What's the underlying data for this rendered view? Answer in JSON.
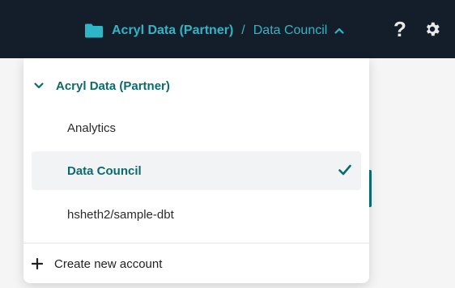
{
  "header": {
    "breadcrumb": {
      "account": "Acryl Data (Partner)",
      "separator": "/",
      "current": "Data Council"
    },
    "icons": [
      "folder-icon",
      "chevron-up-icon",
      "help-icon",
      "gear-icon"
    ],
    "help_glyph": "?"
  },
  "dropdown": {
    "group_label": "Acryl Data (Partner)",
    "items": [
      {
        "label": "Analytics",
        "selected": false
      },
      {
        "label": "Data Council",
        "selected": true
      },
      {
        "label": "hsheth2/sample-dbt",
        "selected": false
      }
    ],
    "create_label": "Create new account"
  },
  "colors": {
    "header_bg": "#141d2a",
    "accent": "#2fb6c6",
    "brand_teal": "#0b6b6b",
    "selected_bg": "#f1f3f4"
  }
}
